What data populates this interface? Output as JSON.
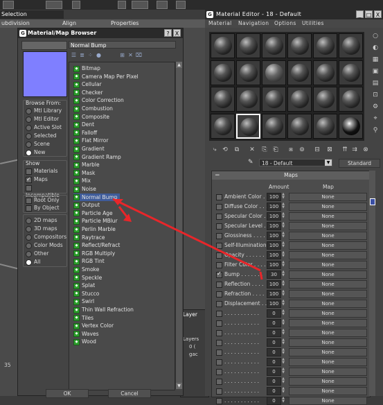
{
  "background": {
    "selection_label": "Selection",
    "tabs": [
      "ubdivision",
      "Align",
      "Properties"
    ],
    "ruler_number": "35"
  },
  "browser": {
    "title": "Material/Map Browser",
    "title_buttons": [
      "?",
      "X"
    ],
    "name_value": "Normal Bump",
    "browse_from": {
      "label": "Browse From:",
      "options": [
        {
          "label": "Mtl Library",
          "checked": false
        },
        {
          "label": "Mtl Editor",
          "checked": false
        },
        {
          "label": "Active Slot",
          "checked": false
        },
        {
          "label": "Selected",
          "checked": false
        },
        {
          "label": "Scene",
          "checked": false
        },
        {
          "label": "New",
          "checked": true
        }
      ]
    },
    "show": {
      "label": "Show",
      "options": [
        {
          "label": "Materials",
          "checked": false
        },
        {
          "label": "Maps",
          "checked": true
        },
        {
          "label": "Incompatible",
          "checked": false
        }
      ]
    },
    "root_options": [
      {
        "label": "Root Only",
        "checked": false
      },
      {
        "label": "By Object",
        "checked": false
      }
    ],
    "type_filter": [
      {
        "label": "2D maps",
        "checked": false
      },
      {
        "label": "3D maps",
        "checked": false
      },
      {
        "label": "Compositors",
        "checked": false
      },
      {
        "label": "Color Mods",
        "checked": false
      },
      {
        "label": "Other",
        "checked": false
      },
      {
        "label": "All",
        "checked": true
      }
    ],
    "maps": [
      "Bitmap",
      "Camera Map Per Pixel",
      "Cellular",
      "Checker",
      "Color Correction",
      "Combustion",
      "Composite",
      "Dent",
      "Falloff",
      "Flat Mirror",
      "Gradient",
      "Gradient Ramp",
      "Marble",
      "Mask",
      "Mix",
      "Noise",
      "Normal Bump",
      "Output",
      "Particle Age",
      "Particle MBlur",
      "Perlin Marble",
      "Raytrace",
      "Reflect/Refract",
      "RGB Multiply",
      "RGB Tint",
      "Smoke",
      "Speckle",
      "Splat",
      "Stucco",
      "Swirl",
      "Thin Wall Refraction",
      "Tiles",
      "Vertex Color",
      "Waves",
      "Wood"
    ],
    "selected_map": "Normal Bump",
    "ok_label": "OK",
    "cancel_label": "Cancel"
  },
  "editor": {
    "title": "Material Editor - 18 - Default",
    "menu": [
      "Material",
      "Navigation",
      "Options",
      "Utilities"
    ],
    "material_name": "18 - Default",
    "material_type": "Standard",
    "maps_header": "Maps",
    "amount_header": "Amount",
    "map_header": "Map",
    "map_rows": [
      {
        "label": "Ambient Color . .",
        "amount": "100",
        "map": "None",
        "checked": false
      },
      {
        "label": "Diffuse Color . . .",
        "amount": "100",
        "map": "None",
        "checked": false
      },
      {
        "label": "Specular Color . .",
        "amount": "100",
        "map": "None",
        "checked": false
      },
      {
        "label": "Specular Level . .",
        "amount": "100",
        "map": "None",
        "checked": false
      },
      {
        "label": "Glossiness . . . . .",
        "amount": "100",
        "map": "None",
        "checked": false
      },
      {
        "label": "Self-Illumination .",
        "amount": "100",
        "map": "None",
        "checked": false
      },
      {
        "label": "Opacity . . . . . .",
        "amount": "100",
        "map": "None",
        "checked": false
      },
      {
        "label": "Filter Color . . . .",
        "amount": "100",
        "map": "None",
        "checked": false
      },
      {
        "label": "Bump . . . . . . .",
        "amount": "30",
        "map": "None",
        "checked": true
      },
      {
        "label": "Reflection . . . .",
        "amount": "100",
        "map": "None",
        "checked": false
      },
      {
        "label": "Refraction . . . .",
        "amount": "100",
        "map": "None",
        "checked": false
      },
      {
        "label": "Displacement . . .",
        "amount": "100",
        "map": "None",
        "checked": false
      },
      {
        "label": ". . . . . . . . . . .",
        "amount": "0",
        "map": "None",
        "checked": false
      },
      {
        "label": ". . . . . . . . . . .",
        "amount": "0",
        "map": "None",
        "checked": false
      },
      {
        "label": ". . . . . . . . . . .",
        "amount": "0",
        "map": "None",
        "checked": false
      },
      {
        "label": ". . . . . . . . . . .",
        "amount": "0",
        "map": "None",
        "checked": false
      },
      {
        "label": ". . . . . . . . . . .",
        "amount": "0",
        "map": "None",
        "checked": false
      },
      {
        "label": ". . . . . . . . . . .",
        "amount": "0",
        "map": "None",
        "checked": false
      },
      {
        "label": ". . . . . . . . . . .",
        "amount": "0",
        "map": "None",
        "checked": false
      },
      {
        "label": ". . . . . . . . . . .",
        "amount": "0",
        "map": "None",
        "checked": false
      },
      {
        "label": ". . . . . . . . . . .",
        "amount": "0",
        "map": "None",
        "checked": false
      },
      {
        "label": ". . . . . . . . . . .",
        "amount": "0",
        "map": "None",
        "checked": false
      }
    ]
  },
  "layer_window": {
    "title": "Layer",
    "label": "Layers",
    "items": [
      "0 (",
      "gac"
    ]
  },
  "colors": {
    "annotation_red": "#e8262a",
    "selection_blue": "#3f5c9a",
    "preview_color": "#7f7fff",
    "map_icon_green": "#2c9f2c"
  }
}
